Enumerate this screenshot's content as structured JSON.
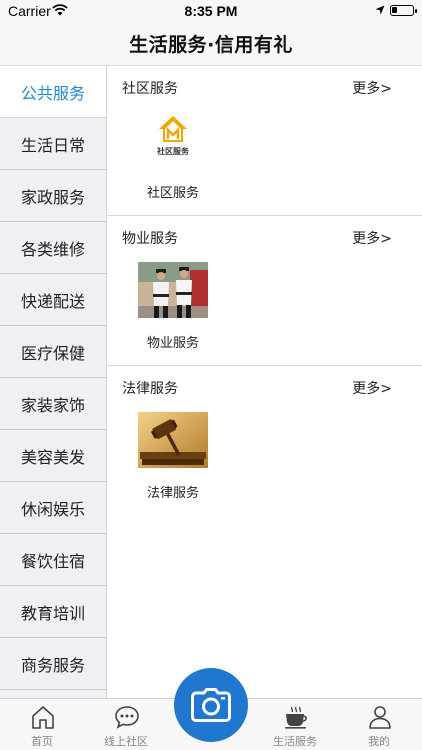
{
  "status_bar": {
    "carrier": "Carrier",
    "time": "8:35 PM"
  },
  "nav": {
    "title": "生活服务·信用有礼"
  },
  "sidebar": {
    "items": [
      {
        "label": "公共服务",
        "active": true
      },
      {
        "label": "生活日常"
      },
      {
        "label": "家政服务"
      },
      {
        "label": "各类维修"
      },
      {
        "label": "快递配送"
      },
      {
        "label": "医疗保健"
      },
      {
        "label": "家装家饰"
      },
      {
        "label": "美容美发"
      },
      {
        "label": "休闲娱乐"
      },
      {
        "label": "餐饮住宿"
      },
      {
        "label": "教育培训"
      },
      {
        "label": "商务服务"
      }
    ]
  },
  "sections": [
    {
      "title": "社区服务",
      "more": "更多>",
      "tile_label": "社区服务",
      "logo_text": "社区服务"
    },
    {
      "title": "物业服务",
      "more": "更多>",
      "tile_label": "物业服务"
    },
    {
      "title": "法律服务",
      "more": "更多>",
      "tile_label": "法律服务"
    }
  ],
  "tab_bar": {
    "tabs": [
      {
        "label": "首页",
        "icon": "home-icon"
      },
      {
        "label": "线上社区",
        "icon": "chat-bubble-icon"
      },
      {
        "label": "",
        "icon": "camera-icon"
      },
      {
        "label": "生活服务",
        "icon": "coffee-cup-icon"
      },
      {
        "label": "我的",
        "icon": "person-icon"
      }
    ]
  },
  "colors": {
    "accent": "#1f88d6",
    "camera_button": "#1f77d0",
    "logo_orange": "#f0a500"
  }
}
